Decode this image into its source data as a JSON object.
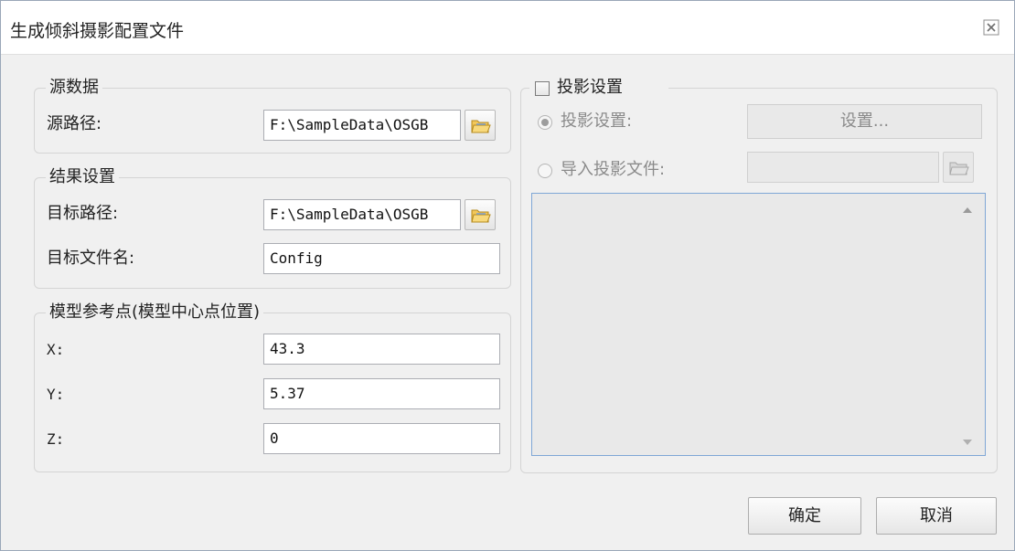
{
  "window": {
    "title": "生成倾斜摄影配置文件"
  },
  "source": {
    "group_label": "源数据",
    "path_label": "源路径:",
    "path_value": "F:\\SampleData\\OSGB"
  },
  "result": {
    "group_label": "结果设置",
    "target_path_label": "目标路径:",
    "target_path_value": "F:\\SampleData\\OSGB",
    "target_file_label": "目标文件名:",
    "target_file_value": "Config"
  },
  "ref_point": {
    "group_label": "模型参考点(模型中心点位置)",
    "x_label": "X:",
    "x_value": "43.3",
    "y_label": "Y:",
    "y_value": "5.37",
    "z_label": "Z:",
    "z_value": "0"
  },
  "projection": {
    "checkbox_label": "投影设置",
    "checked": false,
    "option_settings_label": "投影设置:",
    "settings_button": "设置...",
    "option_import_label": "导入投影文件:",
    "import_value": "",
    "text_content": ""
  },
  "footer": {
    "ok_button": "确定",
    "cancel_button": "取消"
  },
  "icons": {
    "browse": "folder-open-icon",
    "close": "close-icon"
  }
}
